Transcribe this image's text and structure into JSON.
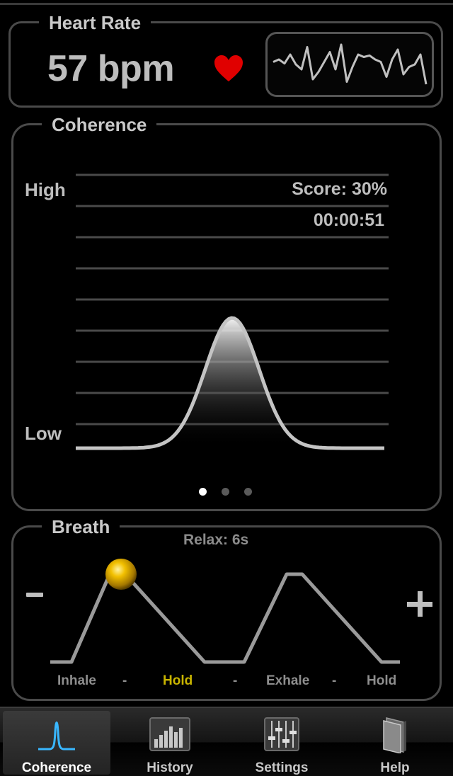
{
  "heart_rate": {
    "title": "Heart Rate",
    "value": "57 bpm",
    "heart_color": "#e00000",
    "waveform": [
      0.55,
      0.6,
      0.52,
      0.7,
      0.5,
      0.4,
      0.85,
      0.2,
      0.35,
      0.55,
      0.75,
      0.4,
      0.9,
      0.15,
      0.45,
      0.7,
      0.65,
      0.68,
      0.6,
      0.55,
      0.25,
      0.6,
      0.8,
      0.3,
      0.45,
      0.5,
      0.7,
      0.1
    ]
  },
  "coherence": {
    "title": "Coherence",
    "high_label": "High",
    "low_label": "Low",
    "score_text": "Score:  30%",
    "timer": "00:00:51",
    "page_dots": 3,
    "active_dot": 0
  },
  "breath": {
    "title": "Breath",
    "relax_text": "Relax: 6s",
    "minus_label": "-",
    "plus_label": "+",
    "phases": [
      "Inhale",
      "-",
      "Hold",
      "-",
      "Exhale",
      "-",
      "Hold"
    ],
    "active_phase_index": 2,
    "active_color": "#c8b400"
  },
  "tabs": [
    {
      "label": "Coherence",
      "icon": "coherence-icon",
      "active": true
    },
    {
      "label": "History",
      "icon": "history-bars-icon",
      "active": false
    },
    {
      "label": "Settings",
      "icon": "sliders-icon",
      "active": false
    },
    {
      "label": "Help",
      "icon": "book-icon",
      "active": false
    }
  ]
}
